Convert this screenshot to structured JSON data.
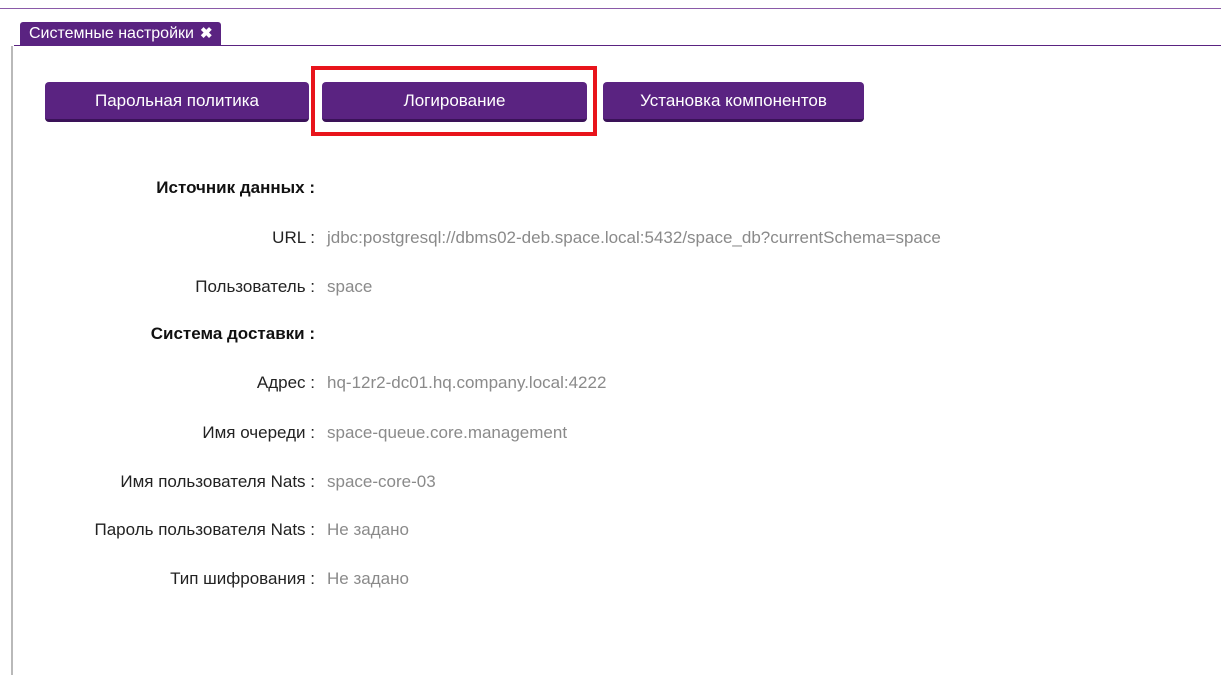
{
  "tab": {
    "title": "Системные настройки",
    "close_glyph": "✖"
  },
  "buttons": {
    "password_policy": "Парольная политика",
    "logging": "Логирование",
    "install_components": "Установка компонентов"
  },
  "colors": {
    "accent": "#5a2381",
    "highlight": "#e8141b"
  },
  "data_source": {
    "title": "Источник данных :",
    "rows": [
      {
        "label": "URL :",
        "value": "jdbc:postgresql://dbms02-deb.space.local:5432/space_db?currentSchema=space"
      },
      {
        "label": "Пользователь :",
        "value": "space"
      }
    ]
  },
  "delivery": {
    "title": "Система доставки :",
    "rows": [
      {
        "label": "Адрес :",
        "value": "hq-12r2-dc01.hq.company.local:4222"
      },
      {
        "label": "Имя очереди :",
        "value": "space-queue.core.management"
      },
      {
        "label": "Имя пользователя Nats :",
        "value": "space-core-03"
      },
      {
        "label": "Пароль пользователя Nats :",
        "value": "Не задано"
      },
      {
        "label": "Тип шифрования :",
        "value": "Не задано"
      }
    ]
  }
}
